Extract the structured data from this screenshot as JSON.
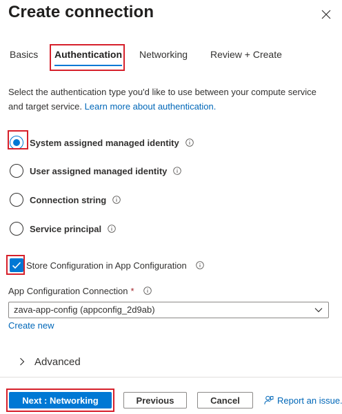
{
  "panel": {
    "title": "Create connection"
  },
  "tabs": [
    {
      "label": "Basics"
    },
    {
      "label": "Authentication"
    },
    {
      "label": "Networking"
    },
    {
      "label": "Review + Create"
    }
  ],
  "description": {
    "text": "Select the authentication type you'd like to use between your compute service and target service.",
    "link": "Learn more about authentication."
  },
  "auth_options": [
    {
      "label": "System assigned managed identity",
      "selected": true
    },
    {
      "label": "User assigned managed identity",
      "selected": false
    },
    {
      "label": "Connection string",
      "selected": false
    },
    {
      "label": "Service principal",
      "selected": false
    }
  ],
  "store_config": {
    "label": "Store Configuration in App Configuration",
    "checked": true
  },
  "app_config_connection": {
    "label": "App Configuration Connection",
    "required_marker": "*",
    "value": "zava-app-config (appconfig_2d9ab)",
    "create_new": "Create new"
  },
  "advanced": {
    "label": "Advanced"
  },
  "footer": {
    "next_label": "Next : Networking",
    "previous_label": "Previous",
    "cancel_label": "Cancel",
    "report_label": "Report an issue."
  },
  "colors": {
    "accent": "#0078d4",
    "highlight": "#d61f2a",
    "link": "#0067b8"
  },
  "icons": {
    "close": "close-icon",
    "info": "info-icon",
    "chevron_down": "chevron-down-icon",
    "chevron_right": "chevron-right-icon",
    "checkmark": "checkmark-icon",
    "feedback": "feedback-person-icon"
  }
}
